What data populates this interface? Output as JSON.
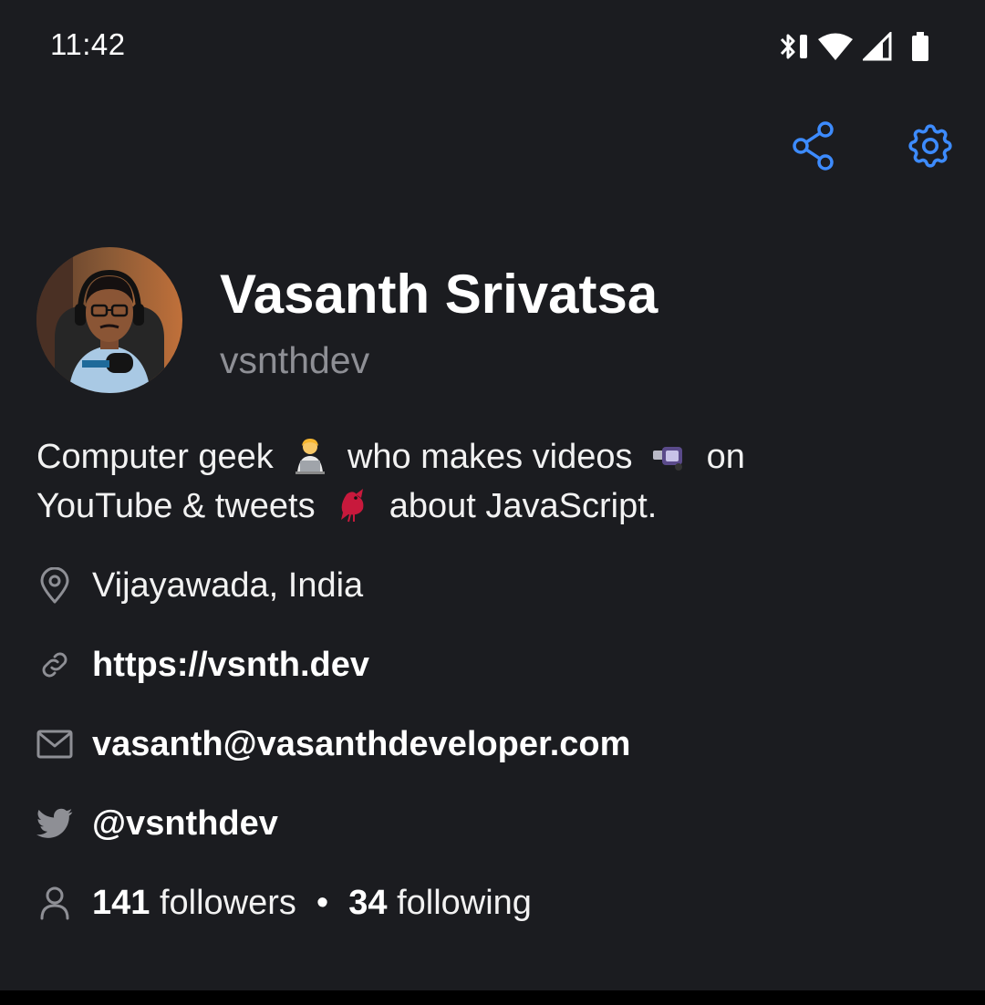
{
  "status_bar": {
    "time": "11:42",
    "icons": [
      "bluetooth-icon",
      "vibrate-icon",
      "wifi-icon",
      "cellular-signal-icon",
      "battery-icon"
    ]
  },
  "toolbar": {
    "share_icon": "share-icon",
    "settings_icon": "gear-icon",
    "accent_color": "#3d8bfd"
  },
  "profile": {
    "name": "Vasanth Srivatsa",
    "username": "vsnthdev",
    "bio": {
      "part1": "Computer geek",
      "part2": "who makes videos",
      "part3": "on",
      "part4": "YouTube & tweets",
      "part5": "about JavaScript."
    },
    "location": "Vijayawada, India",
    "website": "https://vsnth.dev",
    "email": "vasanth@vasanthdeveloper.com",
    "twitter": "@vsnthdev",
    "followers_count": "141",
    "followers_label": "followers",
    "separator": "•",
    "following_count": "34",
    "following_label": "following"
  },
  "colors": {
    "background": "#1b1c20",
    "secondary_text": "#8e8f95",
    "icon_gray": "#8e8f95"
  }
}
